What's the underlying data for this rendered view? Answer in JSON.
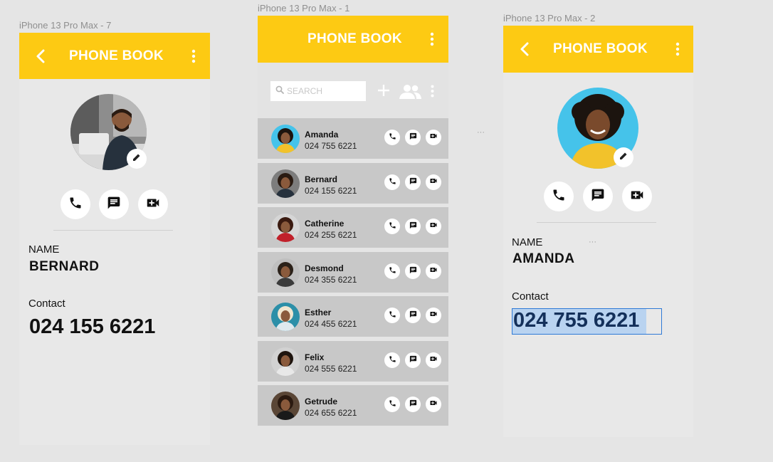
{
  "frames": {
    "left": {
      "label": "iPhone 13 Pro Max - 7",
      "appbar_title": "PHONE BOOK",
      "name_label": "NAME",
      "name_value": "BERNARD",
      "contact_label": "Contact",
      "contact_value": "024 155 6221"
    },
    "middle": {
      "label": "iPhone 13 Pro Max - 1",
      "appbar_title": "PHONE BOOK",
      "search_placeholder": "SEARCH",
      "contacts": [
        {
          "name": "Amanda",
          "phone": "024 755 6221"
        },
        {
          "name": "Bernard",
          "phone": "024 155 6221"
        },
        {
          "name": "Catherine",
          "phone": "024 255 6221"
        },
        {
          "name": "Desmond",
          "phone": "024 355 6221"
        },
        {
          "name": "Esther",
          "phone": "024 455 6221"
        },
        {
          "name": "Felix",
          "phone": "024 555 6221"
        },
        {
          "name": "Getrude",
          "phone": "024 655 6221"
        }
      ]
    },
    "right": {
      "label": "iPhone 13 Pro Max - 2",
      "appbar_title": "PHONE BOOK",
      "name_label": "NAME",
      "name_value": "AMANDA",
      "contact_label": "Contact",
      "contact_value": "024 755 6221"
    }
  },
  "ellipsis": "···",
  "colors": {
    "appbar": "#fdca13",
    "row": "#c8c8c8",
    "selection": "#b9d3f0",
    "selection_border": "#2f7ad6"
  },
  "icons": [
    "back-arrow-icon",
    "more-vert-icon",
    "phone-icon",
    "message-icon",
    "video-call-icon",
    "edit-icon",
    "search-icon",
    "add-icon",
    "group-icon"
  ]
}
